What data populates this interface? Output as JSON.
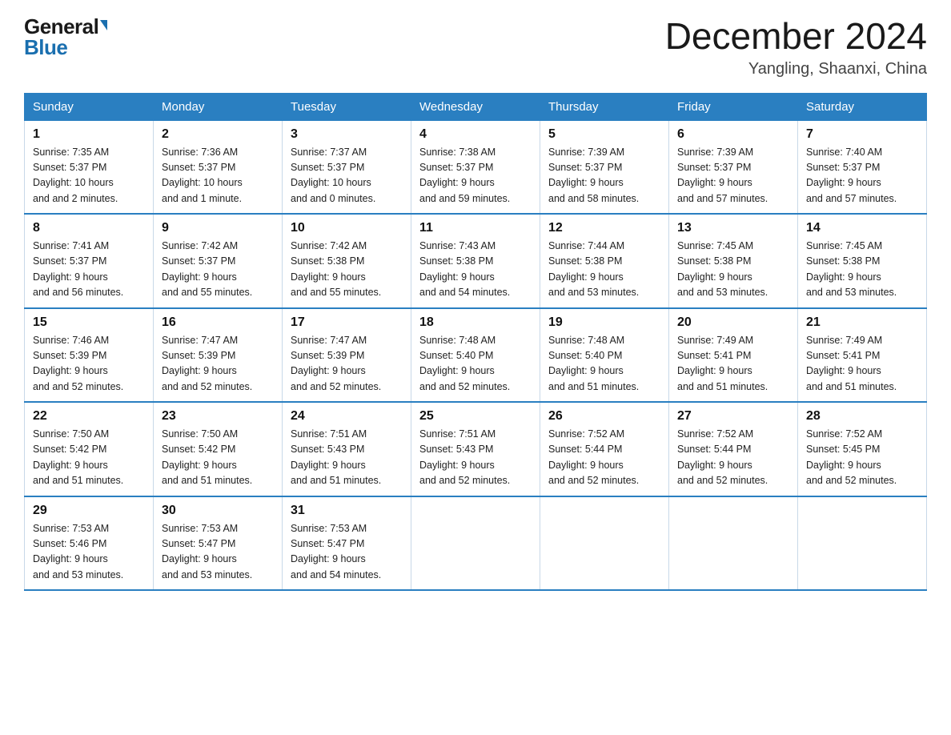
{
  "logo": {
    "general": "General",
    "blue": "Blue"
  },
  "title": "December 2024",
  "subtitle": "Yangling, Shaanxi, China",
  "days_of_week": [
    "Sunday",
    "Monday",
    "Tuesday",
    "Wednesday",
    "Thursday",
    "Friday",
    "Saturday"
  ],
  "weeks": [
    [
      {
        "day": "1",
        "sunrise": "7:35 AM",
        "sunset": "5:37 PM",
        "daylight": "10 hours and 2 minutes."
      },
      {
        "day": "2",
        "sunrise": "7:36 AM",
        "sunset": "5:37 PM",
        "daylight": "10 hours and 1 minute."
      },
      {
        "day": "3",
        "sunrise": "7:37 AM",
        "sunset": "5:37 PM",
        "daylight": "10 hours and 0 minutes."
      },
      {
        "day": "4",
        "sunrise": "7:38 AM",
        "sunset": "5:37 PM",
        "daylight": "9 hours and 59 minutes."
      },
      {
        "day": "5",
        "sunrise": "7:39 AM",
        "sunset": "5:37 PM",
        "daylight": "9 hours and 58 minutes."
      },
      {
        "day": "6",
        "sunrise": "7:39 AM",
        "sunset": "5:37 PM",
        "daylight": "9 hours and 57 minutes."
      },
      {
        "day": "7",
        "sunrise": "7:40 AM",
        "sunset": "5:37 PM",
        "daylight": "9 hours and 57 minutes."
      }
    ],
    [
      {
        "day": "8",
        "sunrise": "7:41 AM",
        "sunset": "5:37 PM",
        "daylight": "9 hours and 56 minutes."
      },
      {
        "day": "9",
        "sunrise": "7:42 AM",
        "sunset": "5:37 PM",
        "daylight": "9 hours and 55 minutes."
      },
      {
        "day": "10",
        "sunrise": "7:42 AM",
        "sunset": "5:38 PM",
        "daylight": "9 hours and 55 minutes."
      },
      {
        "day": "11",
        "sunrise": "7:43 AM",
        "sunset": "5:38 PM",
        "daylight": "9 hours and 54 minutes."
      },
      {
        "day": "12",
        "sunrise": "7:44 AM",
        "sunset": "5:38 PM",
        "daylight": "9 hours and 53 minutes."
      },
      {
        "day": "13",
        "sunrise": "7:45 AM",
        "sunset": "5:38 PM",
        "daylight": "9 hours and 53 minutes."
      },
      {
        "day": "14",
        "sunrise": "7:45 AM",
        "sunset": "5:38 PM",
        "daylight": "9 hours and 53 minutes."
      }
    ],
    [
      {
        "day": "15",
        "sunrise": "7:46 AM",
        "sunset": "5:39 PM",
        "daylight": "9 hours and 52 minutes."
      },
      {
        "day": "16",
        "sunrise": "7:47 AM",
        "sunset": "5:39 PM",
        "daylight": "9 hours and 52 minutes."
      },
      {
        "day": "17",
        "sunrise": "7:47 AM",
        "sunset": "5:39 PM",
        "daylight": "9 hours and 52 minutes."
      },
      {
        "day": "18",
        "sunrise": "7:48 AM",
        "sunset": "5:40 PM",
        "daylight": "9 hours and 52 minutes."
      },
      {
        "day": "19",
        "sunrise": "7:48 AM",
        "sunset": "5:40 PM",
        "daylight": "9 hours and 51 minutes."
      },
      {
        "day": "20",
        "sunrise": "7:49 AM",
        "sunset": "5:41 PM",
        "daylight": "9 hours and 51 minutes."
      },
      {
        "day": "21",
        "sunrise": "7:49 AM",
        "sunset": "5:41 PM",
        "daylight": "9 hours and 51 minutes."
      }
    ],
    [
      {
        "day": "22",
        "sunrise": "7:50 AM",
        "sunset": "5:42 PM",
        "daylight": "9 hours and 51 minutes."
      },
      {
        "day": "23",
        "sunrise": "7:50 AM",
        "sunset": "5:42 PM",
        "daylight": "9 hours and 51 minutes."
      },
      {
        "day": "24",
        "sunrise": "7:51 AM",
        "sunset": "5:43 PM",
        "daylight": "9 hours and 51 minutes."
      },
      {
        "day": "25",
        "sunrise": "7:51 AM",
        "sunset": "5:43 PM",
        "daylight": "9 hours and 52 minutes."
      },
      {
        "day": "26",
        "sunrise": "7:52 AM",
        "sunset": "5:44 PM",
        "daylight": "9 hours and 52 minutes."
      },
      {
        "day": "27",
        "sunrise": "7:52 AM",
        "sunset": "5:44 PM",
        "daylight": "9 hours and 52 minutes."
      },
      {
        "day": "28",
        "sunrise": "7:52 AM",
        "sunset": "5:45 PM",
        "daylight": "9 hours and 52 minutes."
      }
    ],
    [
      {
        "day": "29",
        "sunrise": "7:53 AM",
        "sunset": "5:46 PM",
        "daylight": "9 hours and 53 minutes."
      },
      {
        "day": "30",
        "sunrise": "7:53 AM",
        "sunset": "5:47 PM",
        "daylight": "9 hours and 53 minutes."
      },
      {
        "day": "31",
        "sunrise": "7:53 AM",
        "sunset": "5:47 PM",
        "daylight": "9 hours and 54 minutes."
      },
      null,
      null,
      null,
      null
    ]
  ],
  "sunrise_label": "Sunrise:",
  "sunset_label": "Sunset:",
  "daylight_label": "Daylight:"
}
